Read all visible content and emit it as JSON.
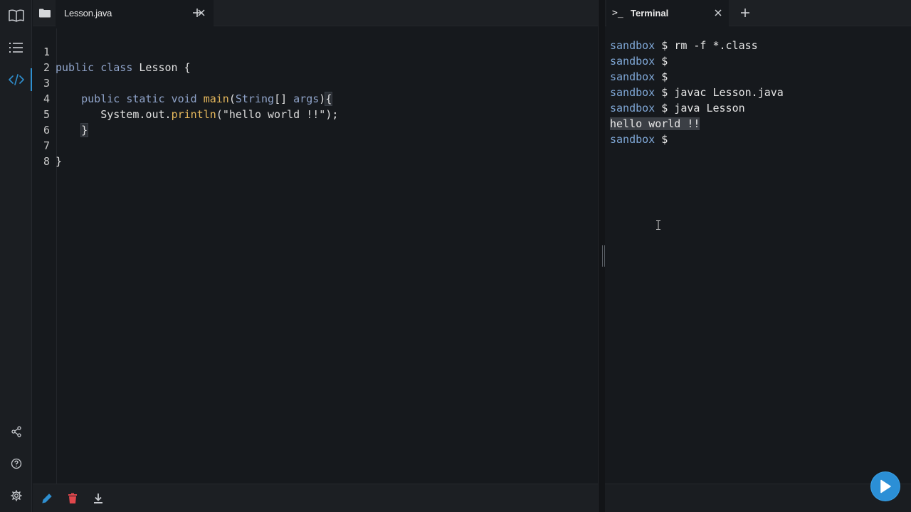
{
  "activity_bar": {
    "items": [
      {
        "name": "book-icon"
      },
      {
        "name": "checklist-icon"
      },
      {
        "name": "code-icon",
        "active": true
      }
    ],
    "bottom_items": [
      {
        "name": "share-icon"
      },
      {
        "name": "help-icon"
      },
      {
        "name": "settings-icon"
      }
    ],
    "accent": "#2f8fcf"
  },
  "editor": {
    "tab_label": "Lesson.java",
    "lines": [
      {
        "num": "1"
      },
      {
        "num": "2"
      },
      {
        "num": "3"
      },
      {
        "num": "4"
      },
      {
        "num": "5"
      },
      {
        "num": "6"
      },
      {
        "num": "7"
      },
      {
        "num": "8"
      }
    ],
    "code": {
      "l1_kw1": "public",
      "l1_kw2": "class",
      "l1_name": "Lesson",
      "l1_brace": "{",
      "l3_kw1": "public",
      "l3_kw2": "static",
      "l3_kw3": "void",
      "l3_fn": "main",
      "l3_open": "(",
      "l3_type": "String",
      "l3_arr": "[]",
      "l3_arg": "args",
      "l3_close": ")",
      "l3_brace": "{",
      "l4_obj": "System",
      "l4_dot1": ".",
      "l4_out": "out",
      "l4_dot2": ".",
      "l4_fn": "println",
      "l4_open": "(",
      "l4_str": "\"hello world !!\"",
      "l4_end": ");",
      "l5_brace": "}",
      "l7_brace": "}"
    }
  },
  "terminal": {
    "tab_icon": ">_",
    "tab_label": "Terminal",
    "prompt": "sandbox",
    "dollar": "$",
    "lines": [
      {
        "type": "cmd",
        "cmd": "rm -f *.class"
      },
      {
        "type": "cmd",
        "cmd": ""
      },
      {
        "type": "cmd",
        "cmd": ""
      },
      {
        "type": "cmd",
        "cmd": "javac Lesson.java"
      },
      {
        "type": "cmd",
        "cmd": "java Lesson"
      },
      {
        "type": "output",
        "text": "hello world !!"
      },
      {
        "type": "cmd",
        "cmd": ""
      }
    ]
  },
  "toolbar": {
    "edit_icon": "pencil-icon",
    "delete_icon": "trash-icon",
    "download_icon": "download-icon"
  },
  "run_button": {
    "icon": "play-icon",
    "color": "#2b8fd6"
  }
}
